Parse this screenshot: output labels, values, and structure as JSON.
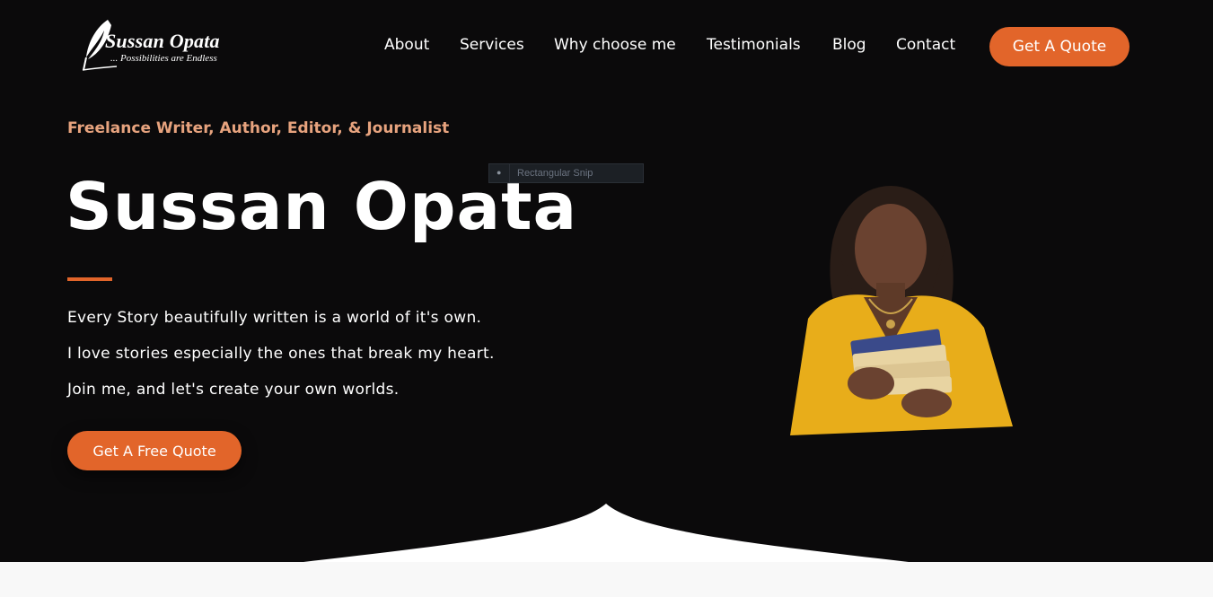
{
  "logo": {
    "name": "Sussan Opata",
    "tagline": "... Possibilities are Endless",
    "icon": "quill-icon"
  },
  "nav": {
    "items": [
      {
        "label": "About"
      },
      {
        "label": "Services"
      },
      {
        "label": "Why choose me"
      },
      {
        "label": "Testimonials"
      },
      {
        "label": "Blog"
      },
      {
        "label": "Contact"
      }
    ],
    "cta_label": "Get A Quote"
  },
  "hero": {
    "subtitle": "Freelance Writer, Author, Editor, & Journalist",
    "title": "Sussan Opata",
    "paragraphs": [
      "Every Story beautifully written is a world of it's own.",
      "I love stories especially the ones that break my heart.",
      "Join me, and let's create your own worlds."
    ],
    "cta_label": "Get A Free Quote"
  },
  "overlay": {
    "snip_label": "Rectangular Snip"
  },
  "colors": {
    "accent": "#e2652a",
    "subtitle": "#e7a37e",
    "background": "#0b0a0b",
    "band": "#f8f8f8"
  }
}
